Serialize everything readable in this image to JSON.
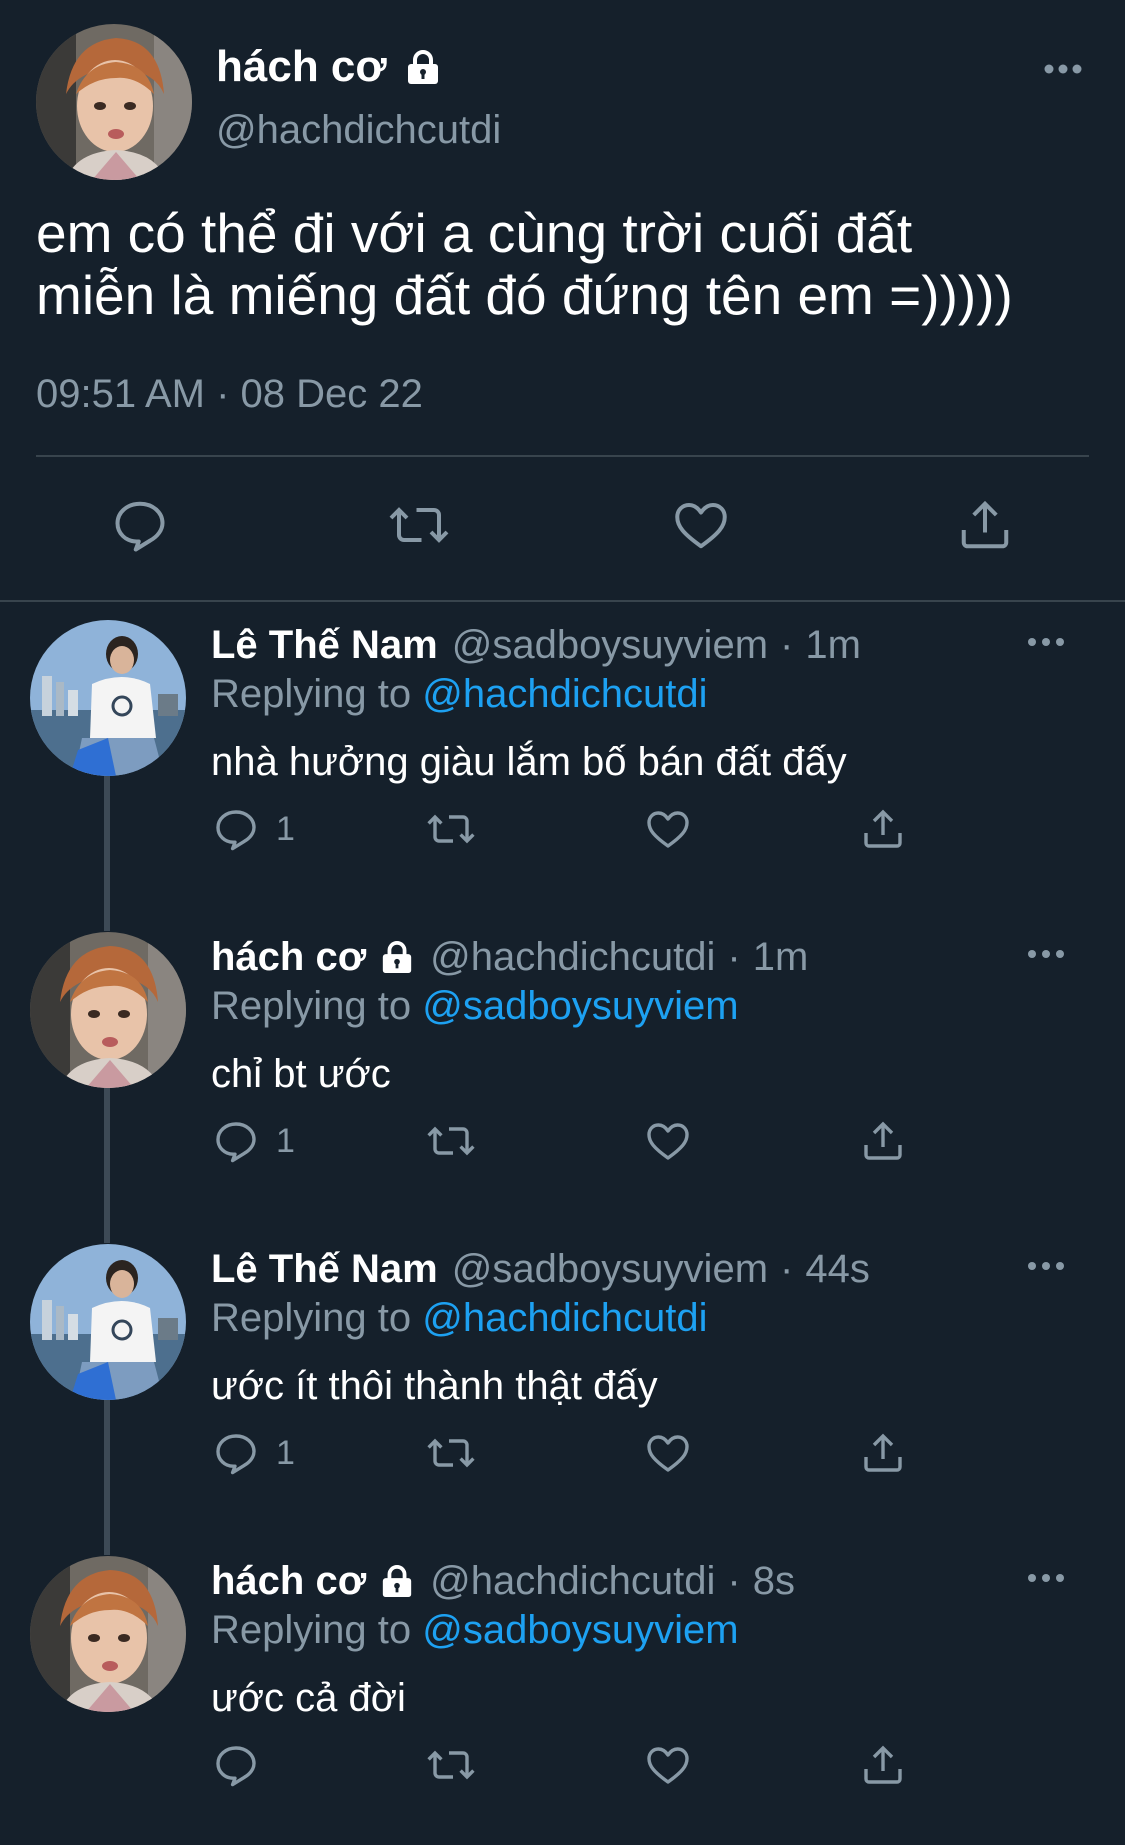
{
  "main_tweet": {
    "display_name": "hách cơ",
    "handle": "@hachdichcutdi",
    "text": "em có thể đi với a cùng trời cuối đất\nmiễn là miếng đất đó đứng tên em =)))))",
    "timestamp": "09:51 AM · 08 Dec 22",
    "locked": true,
    "actions": [
      "reply-icon",
      "retweet-icon",
      "like-icon",
      "share-icon"
    ]
  },
  "replies": [
    {
      "display_name": "Lê Thế Nam",
      "handle": "@sadboysuyviem",
      "separator": "·",
      "time": "1m",
      "locked": false,
      "replying_label": "Replying to",
      "replying_to": "@hachdichcutdi",
      "text": "nhà hưởng giàu lắm bố bán đất đấy",
      "reply_count": "1"
    },
    {
      "display_name": "hách cơ",
      "handle": "@hachdichcutdi",
      "separator": "·",
      "time": "1m",
      "locked": true,
      "replying_label": "Replying to",
      "replying_to": "@sadboysuyviem",
      "text": "chỉ bt ước",
      "reply_count": "1"
    },
    {
      "display_name": "Lê Thế Nam",
      "handle": "@sadboysuyviem",
      "separator": "·",
      "time": "44s",
      "locked": false,
      "replying_label": "Replying to",
      "replying_to": "@hachdichcutdi",
      "text": "ước ít thôi thành thật đấy",
      "reply_count": "1"
    },
    {
      "display_name": "hách cơ",
      "handle": "@hachdichcutdi",
      "separator": "·",
      "time": "8s",
      "locked": true,
      "replying_label": "Replying to",
      "replying_to": "@sadboysuyviem",
      "text": "ước cả đời",
      "reply_count": ""
    }
  ],
  "colors": {
    "background": "#15202b",
    "text_primary": "#ffffff",
    "text_secondary": "#8899a6",
    "link": "#1da1f2",
    "divider": "#38444d"
  }
}
